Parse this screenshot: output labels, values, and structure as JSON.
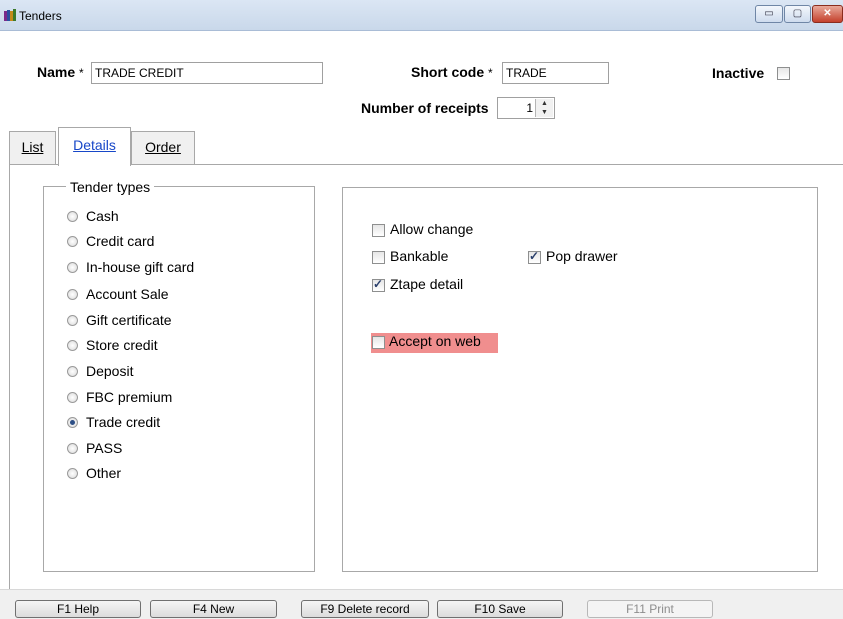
{
  "window": {
    "title": "Tenders",
    "min_glyph": "▭",
    "max_glyph": "▢",
    "close_glyph": "✕"
  },
  "header": {
    "name_label": "Name",
    "name_value": "TRADE CREDIT",
    "short_code_label": "Short code",
    "short_code_value": "TRADE",
    "required_mark": "*",
    "inactive_label": "Inactive",
    "inactive_checked": false,
    "receipts_label": "Number of receipts",
    "receipts_value": "1"
  },
  "tabs": [
    {
      "label": "List",
      "active": false
    },
    {
      "label": "Details",
      "active": true
    },
    {
      "label": "Order",
      "active": false
    }
  ],
  "tender_types": {
    "title": "Tender types",
    "options": [
      {
        "label": "Cash",
        "selected": false
      },
      {
        "label": "Credit card",
        "selected": false
      },
      {
        "label": "In-house gift card",
        "selected": false
      },
      {
        "label": "Account Sale",
        "selected": false
      },
      {
        "label": "Gift certificate",
        "selected": false
      },
      {
        "label": "Store credit",
        "selected": false
      },
      {
        "label": "Deposit",
        "selected": false
      },
      {
        "label": "FBC premium",
        "selected": false
      },
      {
        "label": "Trade credit",
        "selected": true
      },
      {
        "label": "PASS",
        "selected": false
      },
      {
        "label": "Other",
        "selected": false
      }
    ]
  },
  "options": {
    "allow_change": {
      "label": "Allow change",
      "checked": false
    },
    "bankable": {
      "label": "Bankable",
      "checked": false
    },
    "pop_drawer": {
      "label": "Pop drawer",
      "checked": true
    },
    "ztape_detail": {
      "label": "Ztape detail",
      "checked": true
    },
    "accept_on_web": {
      "label": "Accept on web",
      "checked": false
    }
  },
  "footer": {
    "help": "F1 Help",
    "new": "F4 New",
    "delete": "F9 Delete record",
    "save": "F10 Save",
    "print": "F11 Print"
  },
  "colors": {
    "highlight": "#f08e8e",
    "active_tab_text": "#1747c8"
  }
}
